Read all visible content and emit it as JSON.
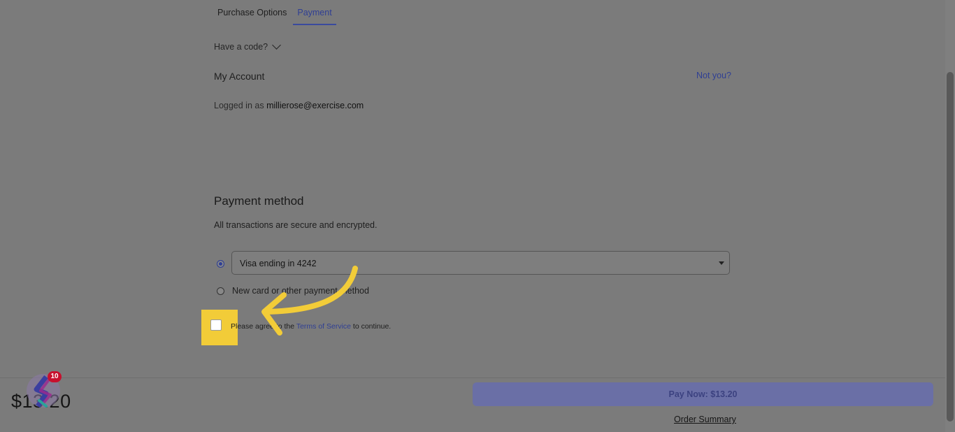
{
  "tabs": [
    {
      "label": "Purchase Options"
    },
    {
      "label": "Payment"
    }
  ],
  "code_toggle": {
    "label": "Have a code?",
    "icon": "chevron-down-icon"
  },
  "account": {
    "title": "My Account",
    "not_you": "Not you?",
    "logged_in_prefix": "Logged in as",
    "email": "millierose@exercise.com"
  },
  "payment": {
    "title": "Payment method",
    "subtitle": "All transactions are secure and encrypted.",
    "saved_card": "Visa ending in 4242",
    "new_card": "New card or other payment method"
  },
  "tos": {
    "prefix": "Please agree to the",
    "link": "Terms of Service",
    "suffix": "to continue."
  },
  "footer": {
    "price": "$13.20",
    "pay_button": "Pay Now: $13.20",
    "order_summary": "Order Summary"
  },
  "app_badge": {
    "count": "10"
  },
  "colors": {
    "accent": "#2f3f94",
    "highlight": "#f2cc38",
    "overlay": "#7b7b7b"
  }
}
